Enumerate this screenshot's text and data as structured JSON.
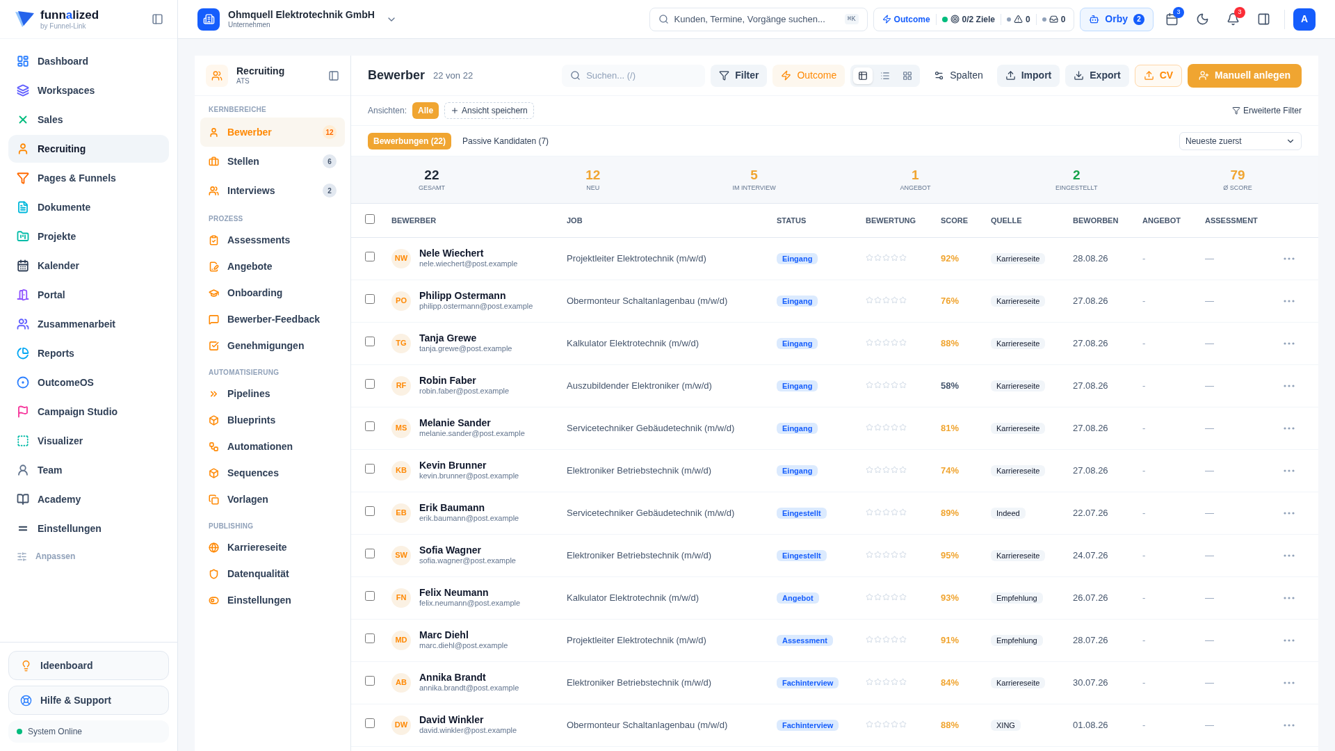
{
  "brand": {
    "name_start": "funn",
    "name_accent": "a",
    "name_end": "lized",
    "tagline": "by Funnel-Link"
  },
  "company": {
    "name": "Ohmquell Elektrotechnik GmbH",
    "type": "Unternehmen"
  },
  "global_search": {
    "placeholder": "Kunden, Termine, Vorgänge suchen...",
    "shortcut": "⌘K"
  },
  "status_pills": {
    "outcome": "Outcome",
    "goals": "0/2 Ziele",
    "alerts": "0",
    "inbox": "0"
  },
  "orby": {
    "label": "Orby",
    "badge": "2"
  },
  "calendar_badge": "3",
  "notifications_badge": "3",
  "avatar": "A",
  "sidebar": {
    "items": [
      {
        "label": "Dashboard",
        "selected": false
      },
      {
        "label": "Workspaces",
        "selected": false
      },
      {
        "label": "Sales",
        "selected": false
      },
      {
        "label": "Recruiting",
        "selected": true
      },
      {
        "label": "Pages & Funnels",
        "selected": false
      },
      {
        "label": "Dokumente",
        "selected": false
      },
      {
        "label": "Projekte",
        "selected": false
      },
      {
        "label": "Kalender",
        "selected": false
      },
      {
        "label": "Portal",
        "selected": false
      },
      {
        "label": "Zusammenarbeit",
        "selected": false
      },
      {
        "label": "Reports",
        "selected": false
      },
      {
        "label": "OutcomeOS",
        "selected": false
      },
      {
        "label": "Campaign Studio",
        "selected": false
      },
      {
        "label": "Visualizer",
        "selected": false
      },
      {
        "label": "Team",
        "selected": false
      },
      {
        "label": "Academy",
        "selected": false
      },
      {
        "label": "Einstellungen",
        "selected": false
      }
    ],
    "customize": "Anpassen",
    "bottom_buttons": [
      "Ideenboard",
      "Hilfe & Support"
    ],
    "system_status": {
      "label": "System Online",
      "online": true
    }
  },
  "module_nav": {
    "title": "Recruiting",
    "subtitle": "ATS",
    "sections": [
      {
        "heading": "KERNBEREICHE",
        "items": [
          {
            "label": "Bewerber",
            "count": "12",
            "selected": true
          },
          {
            "label": "Stellen",
            "count": "6",
            "selected": false
          },
          {
            "label": "Interviews",
            "count": "2",
            "selected": false
          }
        ]
      },
      {
        "heading": "PROZESS",
        "items": [
          {
            "label": "Assessments",
            "selected": false
          },
          {
            "label": "Angebote",
            "selected": false
          },
          {
            "label": "Onboarding",
            "selected": false
          },
          {
            "label": "Bewerber-Feedback",
            "selected": false
          },
          {
            "label": "Genehmigungen",
            "selected": false
          }
        ]
      },
      {
        "heading": "AUTOMATISIERUNG",
        "items": [
          {
            "label": "Pipelines",
            "selected": false
          },
          {
            "label": "Blueprints",
            "selected": false
          },
          {
            "label": "Automationen",
            "selected": false
          },
          {
            "label": "Sequences",
            "selected": false
          },
          {
            "label": "Vorlagen",
            "selected": false
          }
        ]
      },
      {
        "heading": "PUBLISHING",
        "items": [
          {
            "label": "Karriereseite",
            "selected": false
          },
          {
            "label": "Datenqualität",
            "selected": false
          },
          {
            "label": "Einstellungen",
            "selected": false
          }
        ]
      }
    ]
  },
  "toolbar": {
    "title": "Bewerber",
    "count": "22 von 22",
    "search_placeholder": "Suchen... (/)",
    "filter": "Filter",
    "outcome": "Outcome",
    "view_modes": [
      {
        "selected": true
      },
      {
        "selected": false
      },
      {
        "selected": false
      }
    ],
    "columns": "Spalten",
    "import": "Import",
    "export": "Export",
    "cv": "CV",
    "create": "Manuell anlegen"
  },
  "views": {
    "label": "Ansichten:",
    "items": [
      {
        "label": "Alle",
        "selected": true
      }
    ],
    "save": "Ansicht speichern",
    "advanced_filter": "Erweiterte Filter"
  },
  "tabs": [
    {
      "label": "Bewerbungen (22)",
      "selected": true
    },
    {
      "label": "Passive Kandidaten (7)",
      "selected": false
    }
  ],
  "sort": {
    "value": "Neueste zuerst"
  },
  "stats": [
    {
      "value": "22",
      "label": "GESAMT",
      "color": "#1f2937"
    },
    {
      "value": "12",
      "label": "NEU",
      "color": "#f0a531"
    },
    {
      "value": "5",
      "label": "IM INTERVIEW",
      "color": "#f0a531"
    },
    {
      "value": "1",
      "label": "ANGEBOT",
      "color": "#f0a531"
    },
    {
      "value": "2",
      "label": "EINGESTELLT",
      "color": "#16a34a"
    },
    {
      "value": "79",
      "label": "Ø SCORE",
      "color": "#f0a531"
    }
  ],
  "table": {
    "select_all": false,
    "columns": [
      "BEWERBER",
      "JOB",
      "STATUS",
      "BEWERTUNG",
      "SCORE",
      "QUELLE",
      "BEWORBEN",
      "ANGEBOT",
      "ASSESSMENT"
    ],
    "rows": [
      {
        "initials": "NW",
        "name": "Nele Wiechert",
        "email": "nele.wiechert@post.example",
        "job": "Projektleiter Elektrotechnik (m/w/d)",
        "status": "Eingang",
        "stars": 0,
        "score": "92%",
        "score_high": true,
        "source": "Karriereseite",
        "applied": "28.08.26",
        "offer": "-",
        "assessment": "—",
        "checked": false
      },
      {
        "initials": "PO",
        "name": "Philipp Ostermann",
        "email": "philipp.ostermann@post.example",
        "job": "Obermonteur Schaltanlagenbau (m/w/d)",
        "status": "Eingang",
        "stars": 0,
        "score": "76%",
        "score_high": true,
        "source": "Karriereseite",
        "applied": "27.08.26",
        "offer": "-",
        "assessment": "—",
        "checked": false
      },
      {
        "initials": "TG",
        "name": "Tanja Grewe",
        "email": "tanja.grewe@post.example",
        "job": "Kalkulator Elektrotechnik (m/w/d)",
        "status": "Eingang",
        "stars": 0,
        "score": "88%",
        "score_high": true,
        "source": "Karriereseite",
        "applied": "27.08.26",
        "offer": "-",
        "assessment": "—",
        "checked": false
      },
      {
        "initials": "RF",
        "name": "Robin Faber",
        "email": "robin.faber@post.example",
        "job": "Auszubildender Elektroniker (m/w/d)",
        "status": "Eingang",
        "stars": 0,
        "score": "58%",
        "score_high": false,
        "source": "Karriereseite",
        "applied": "27.08.26",
        "offer": "-",
        "assessment": "—",
        "checked": false
      },
      {
        "initials": "MS",
        "name": "Melanie Sander",
        "email": "melanie.sander@post.example",
        "job": "Servicetechniker Gebäudetechnik (m/w/d)",
        "status": "Eingang",
        "stars": 0,
        "score": "81%",
        "score_high": true,
        "source": "Karriereseite",
        "applied": "27.08.26",
        "offer": "-",
        "assessment": "—",
        "checked": false
      },
      {
        "initials": "KB",
        "name": "Kevin Brunner",
        "email": "kevin.brunner@post.example",
        "job": "Elektroniker Betriebstechnik (m/w/d)",
        "status": "Eingang",
        "stars": 0,
        "score": "74%",
        "score_high": true,
        "source": "Karriereseite",
        "applied": "27.08.26",
        "offer": "-",
        "assessment": "—",
        "checked": false
      },
      {
        "initials": "EB",
        "name": "Erik Baumann",
        "email": "erik.baumann@post.example",
        "job": "Servicetechniker Gebäudetechnik (m/w/d)",
        "status": "Eingestellt",
        "stars": 0,
        "score": "89%",
        "score_high": true,
        "source": "Indeed",
        "applied": "22.07.26",
        "offer": "-",
        "assessment": "—",
        "checked": false
      },
      {
        "initials": "SW",
        "name": "Sofia Wagner",
        "email": "sofia.wagner@post.example",
        "job": "Elektroniker Betriebstechnik (m/w/d)",
        "status": "Eingestellt",
        "stars": 0,
        "score": "95%",
        "score_high": true,
        "source": "Karriereseite",
        "applied": "24.07.26",
        "offer": "-",
        "assessment": "—",
        "checked": false
      },
      {
        "initials": "FN",
        "name": "Felix Neumann",
        "email": "felix.neumann@post.example",
        "job": "Kalkulator Elektrotechnik (m/w/d)",
        "status": "Angebot",
        "stars": 0,
        "score": "93%",
        "score_high": true,
        "source": "Empfehlung",
        "applied": "26.07.26",
        "offer": "-",
        "assessment": "—",
        "checked": false
      },
      {
        "initials": "MD",
        "name": "Marc Diehl",
        "email": "marc.diehl@post.example",
        "job": "Projektleiter Elektrotechnik (m/w/d)",
        "status": "Assessment",
        "stars": 0,
        "score": "91%",
        "score_high": true,
        "source": "Empfehlung",
        "applied": "28.07.26",
        "offer": "-",
        "assessment": "—",
        "checked": false
      },
      {
        "initials": "AB",
        "name": "Annika Brandt",
        "email": "annika.brandt@post.example",
        "job": "Elektroniker Betriebstechnik (m/w/d)",
        "status": "Fachinterview",
        "stars": 0,
        "score": "84%",
        "score_high": true,
        "source": "Karriereseite",
        "applied": "30.07.26",
        "offer": "-",
        "assessment": "—",
        "checked": false
      },
      {
        "initials": "DW",
        "name": "David Winkler",
        "email": "david.winkler@post.example",
        "job": "Obermonteur Schaltanlagenbau (m/w/d)",
        "status": "Fachinterview",
        "stars": 0,
        "score": "88%",
        "score_high": true,
        "source": "XING",
        "applied": "01.08.26",
        "offer": "-",
        "assessment": "—",
        "checked": false
      }
    ]
  }
}
